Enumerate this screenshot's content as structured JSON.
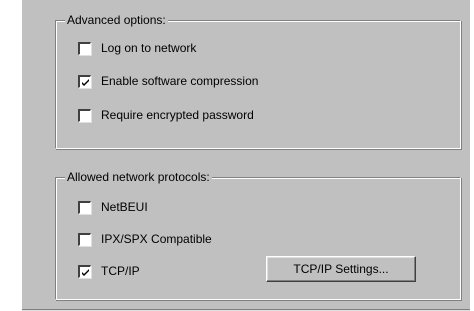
{
  "advanced_options": {
    "caption": "Advanced options:",
    "items": [
      {
        "label": "Log on to network",
        "checked": false
      },
      {
        "label": "Enable software compression",
        "checked": true
      },
      {
        "label": "Require encrypted password",
        "checked": false
      }
    ]
  },
  "allowed_protocols": {
    "caption": "Allowed network protocols:",
    "items": [
      {
        "label": "NetBEUI",
        "checked": false
      },
      {
        "label": "IPX/SPX Compatible",
        "checked": false
      },
      {
        "label": "TCP/IP",
        "checked": true
      }
    ],
    "settings_button_label": "TCP/IP Settings..."
  }
}
